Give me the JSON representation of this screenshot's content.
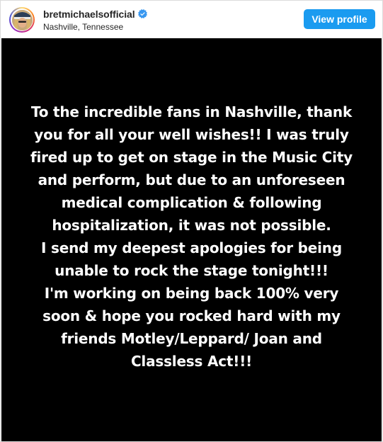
{
  "header": {
    "username": "bretmichaelsofficial",
    "location": "Nashville, Tennessee",
    "view_profile_label": "View profile",
    "avatar_icon": "profile-avatar",
    "verified_icon": "verified-badge-icon",
    "accent_color": "#1a9bf0"
  },
  "post": {
    "background_color": "#000000",
    "text_color": "#ffffff",
    "lines": [
      "To the incredible fans in Nashville, thank",
      "you for all your well wishes!!  I was truly",
      "fired up to get on stage in the Music City",
      "and perform, but due to an unforeseen",
      "medical complication & following",
      "hospitalization, it was not possible.",
      "I send my deepest apologies for being",
      "unable to rock the stage tonight!!!",
      "I'm working on being back 100% very",
      "soon & hope you rocked hard with my",
      "friends Motley/Leppard/ Joan and",
      "Classless Act!!!"
    ]
  }
}
